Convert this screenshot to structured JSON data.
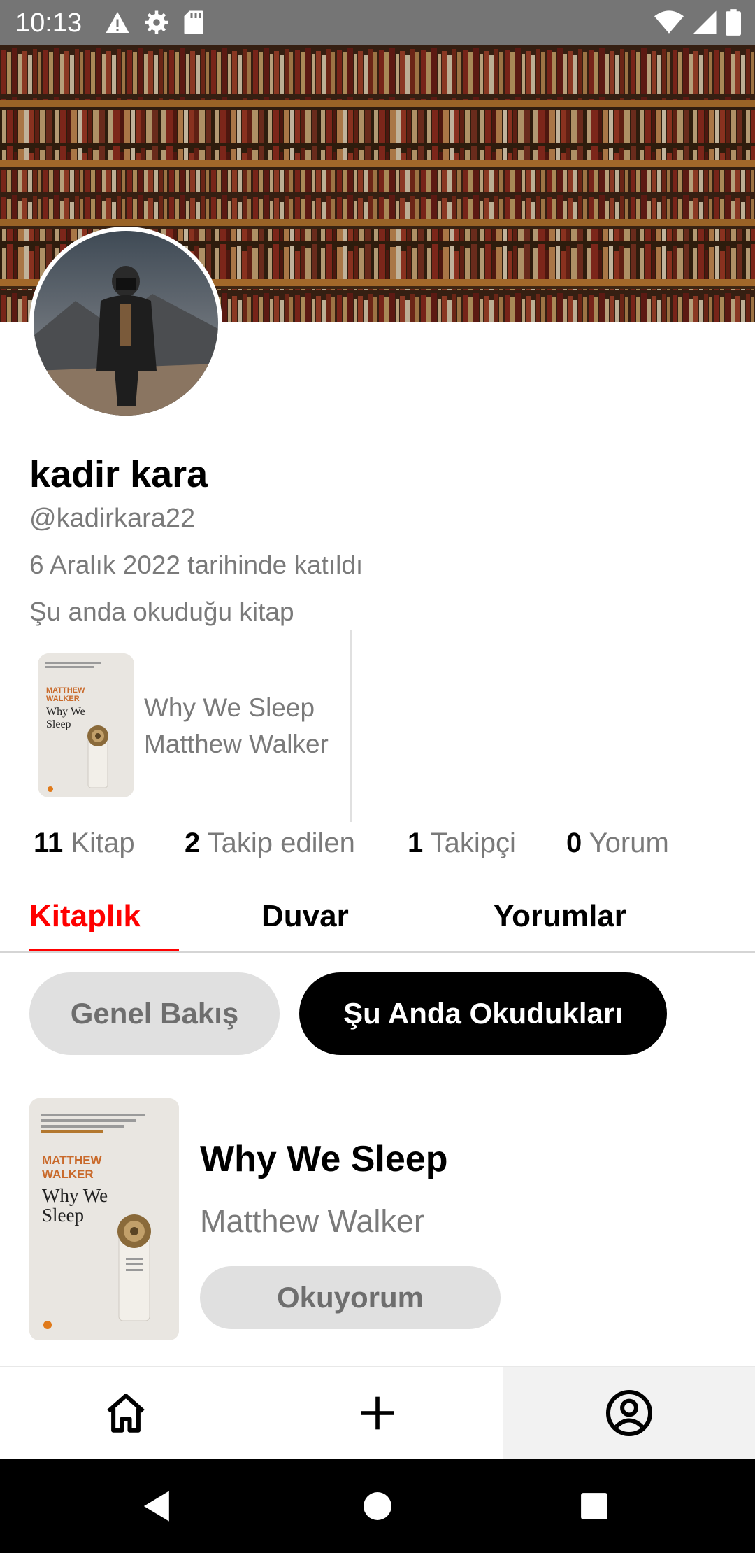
{
  "status_bar": {
    "time": "10:13",
    "left_icons": [
      "warning-icon",
      "settings-icon",
      "sd-card-icon"
    ],
    "right_icons": [
      "wifi-icon",
      "cellular-signal-icon",
      "battery-icon"
    ]
  },
  "profile": {
    "name": "kadir kara",
    "handle": "@kadirkara22",
    "joined": "6 Aralık 2022 tarihinde katıldı",
    "current_label": "Şu anda okuduğu kitap",
    "current_book": {
      "title": "Why We Sleep",
      "author": "Matthew Walker",
      "cover": {
        "author_line1": "MATTHEW",
        "author_line2": "WALKER",
        "title_line1": "Why We",
        "title_line2": "Sleep"
      }
    }
  },
  "stats": [
    {
      "value": "11",
      "label": "Kitap"
    },
    {
      "value": "2",
      "label": "Takip edilen"
    },
    {
      "value": "1",
      "label": "Takipçi"
    },
    {
      "value": "0",
      "label": "Yorum"
    }
  ],
  "tabs": [
    {
      "label": "Kitaplık",
      "active": true
    },
    {
      "label": "Duvar",
      "active": false
    },
    {
      "label": "Yorumlar",
      "active": false
    }
  ],
  "filter_chips": [
    {
      "label": "Genel Bakış",
      "selected": false
    },
    {
      "label": "Şu Anda Okudukları",
      "selected": true
    }
  ],
  "books": [
    {
      "title": "Why We Sleep",
      "author": "Matthew Walker",
      "status": "Okuyorum",
      "cover": {
        "author_line1": "MATTHEW",
        "author_line2": "WALKER",
        "title_line1": "Why We",
        "title_line2": "Sleep"
      }
    }
  ],
  "bottom_nav": [
    {
      "icon": "home-icon",
      "selected": false
    },
    {
      "icon": "add-icon",
      "selected": false
    },
    {
      "icon": "account-icon",
      "selected": true
    }
  ],
  "system_nav": [
    "back-icon",
    "home-circle-icon",
    "recents-icon"
  ],
  "colors": {
    "accent": "#ff0000",
    "status_bar": "#757575",
    "chip_active": "#000000",
    "chip_inactive": "#e0e0e0",
    "muted_text": "#7a7a7a"
  }
}
